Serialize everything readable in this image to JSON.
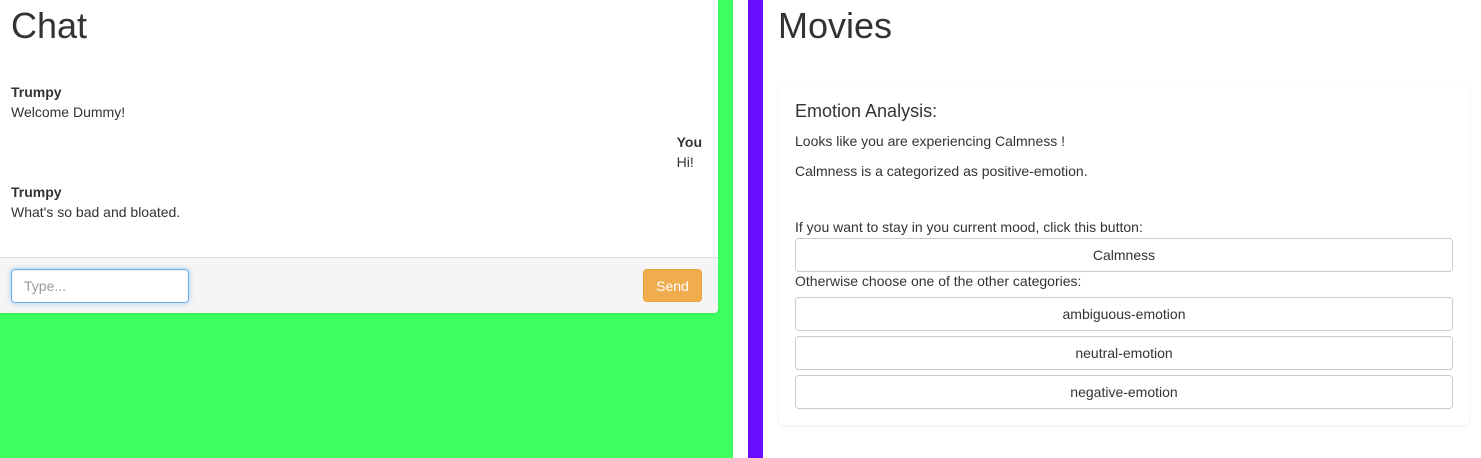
{
  "chat": {
    "title": "Chat",
    "messages": [
      {
        "sender": "Trumpy",
        "text": "Welcome Dummy!",
        "side": "left"
      },
      {
        "sender": "You",
        "text": "Hi!",
        "side": "right"
      },
      {
        "sender": "Trumpy",
        "text": "What's so bad and bloated.",
        "side": "left"
      }
    ],
    "input": {
      "placeholder": "Type...",
      "value": ""
    },
    "send_label": "Send"
  },
  "movies": {
    "title": "Movies",
    "analysis": {
      "heading": "Emotion Analysis:",
      "line1": "Looks like you are experiencing Calmness !",
      "line2": "Calmness is a categorized as positive-emotion.",
      "stay_prompt": "If you want to stay in you current mood, click this button:",
      "current_button": "Calmness",
      "other_prompt": "Otherwise choose one of the other categories:",
      "categories": [
        "ambiguous-emotion",
        "neutral-emotion",
        "negative-emotion"
      ]
    }
  },
  "colors": {
    "chat_background": "#3dff5e",
    "divider_stripe": "#6a0dff",
    "send_button": "#f0ad4e",
    "input_focus": "#66afe9"
  }
}
